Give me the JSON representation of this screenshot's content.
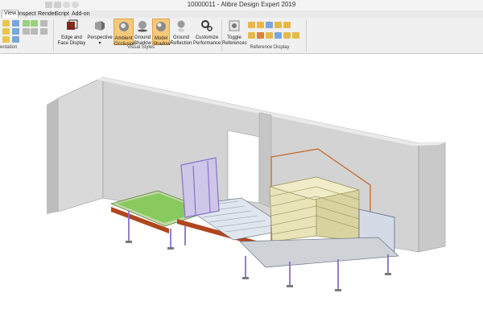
{
  "window": {
    "title": "10000011 - Alibre Design Expert 2019"
  },
  "menu": {
    "items": [
      {
        "label": "View",
        "active": true
      },
      {
        "label": "Inspect"
      },
      {
        "label": "Render"
      },
      {
        "label": "Script"
      },
      {
        "label": "Add-on"
      }
    ]
  },
  "ribbon": {
    "groups": {
      "orientation": "entation",
      "visual_styles": "Visual Styles",
      "reference_display": "Reference Display"
    },
    "buttons": {
      "edge_face": {
        "l1": "Edge and",
        "l2": "Face Display"
      },
      "perspective": {
        "l1": "Perspective",
        "l2": ""
      },
      "ambient_occlusion": {
        "l1": "Ambient",
        "l2": "Occlusion"
      },
      "ground_shadow": {
        "l1": "Ground",
        "l2": "Shadow"
      },
      "model_shadow": {
        "l1": "Model",
        "l2": "Shadow"
      },
      "ground_reflection": {
        "l1": "Ground",
        "l2": "Reflection"
      },
      "customize_performance": {
        "l1": "Customize",
        "l2": "Performance"
      },
      "toggle_references": {
        "l1": "Toggle",
        "l2": "References"
      }
    }
  },
  "colors": {
    "accent_active": "#f7c97a",
    "wall": "#d6d6d6",
    "pallet": "#e8e4b8",
    "conveyor_green": "#7ec850",
    "frame_red": "#b0461f",
    "frame_purple": "#8b6fc9"
  }
}
